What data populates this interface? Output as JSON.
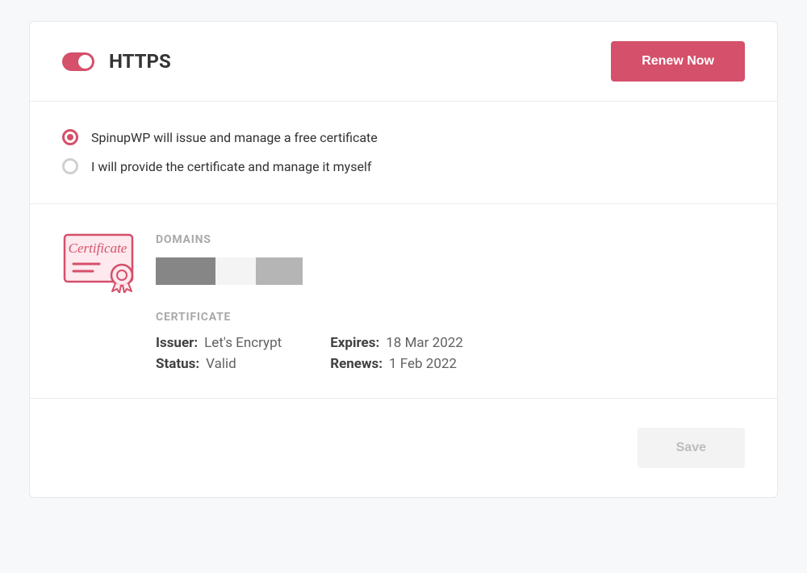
{
  "header": {
    "title": "HTTPS",
    "toggle_on": true,
    "renew_button": "Renew Now"
  },
  "options": [
    {
      "label": "SpinupWP will issue and manage a free certificate",
      "selected": true
    },
    {
      "label": "I will provide the certificate and manage it myself",
      "selected": false
    }
  ],
  "details": {
    "domains_label": "DOMAINS",
    "certificate_label": "CERTIFICATE",
    "issuer_label": "Issuer:",
    "issuer_value": "Let's Encrypt",
    "status_label": "Status:",
    "status_value": "Valid",
    "expires_label": "Expires:",
    "expires_value": "18 Mar 2022",
    "renews_label": "Renews:",
    "renews_value": "1 Feb 2022"
  },
  "footer": {
    "save_button": "Save"
  }
}
